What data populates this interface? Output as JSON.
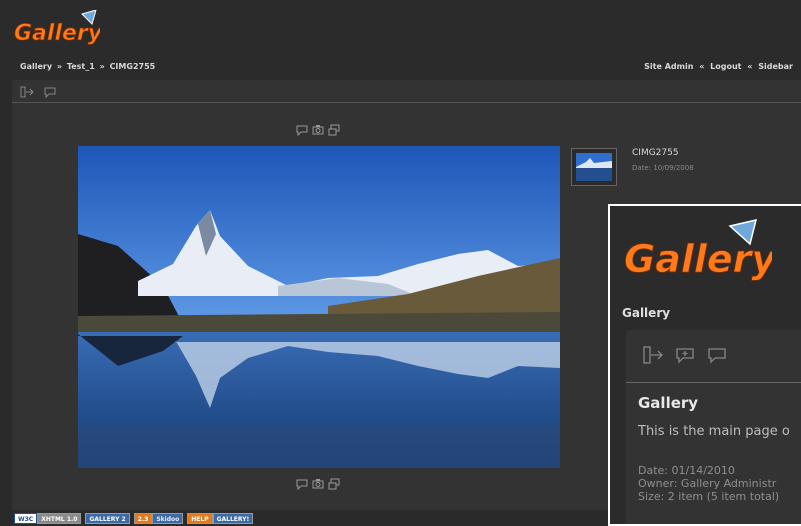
{
  "header": {
    "logo_text": "Gallery",
    "breadcrumb": [
      "Gallery",
      "»",
      "Test_1",
      "»",
      "CIMG2755"
    ],
    "links": [
      "Site Admin",
      "«",
      "Logout",
      "«",
      "Sidebar"
    ]
  },
  "toolbar": {
    "icons": [
      "login-icon",
      "comment-icon"
    ]
  },
  "photo_actions": {
    "icons": [
      "comment-icon",
      "camera-icon",
      "slideshow-icon"
    ]
  },
  "item": {
    "title": "CIMG2755",
    "date": "Date: 10/09/2008"
  },
  "overlay": {
    "logo_text": "Gallery",
    "breadcrumb": "Gallery",
    "toolbar_icons": [
      "login-icon",
      "add-comment-icon",
      "comment-icon"
    ],
    "title": "Gallery",
    "description": "This is the main page o",
    "date": "Date: 01/14/2010",
    "owner": "Owner: Gallery Administr",
    "size": "Size: 2 item (5 item total)"
  },
  "footer": {
    "badges": [
      "W3C",
      "XHTML 1.0",
      "GALLERY 2",
      "2.3",
      "Skidoo",
      "HELP",
      "GALLERY!"
    ]
  },
  "colors": {
    "background": "#2a2a2a",
    "panel": "#333333",
    "logo_orange": "#ff7a1a",
    "sky": "#2f6fd0"
  }
}
